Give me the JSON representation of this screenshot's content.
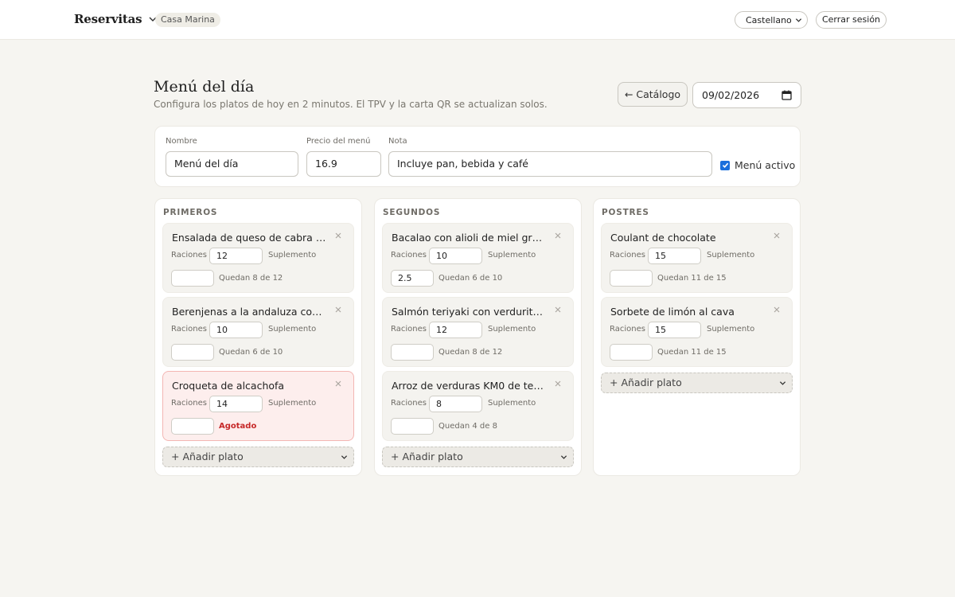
{
  "topbar": {
    "brand": "Reservitas",
    "restaurant": "Casa Marina",
    "language": "Castellano",
    "logout_label": "Cerrar sesión"
  },
  "header": {
    "title": "Menú del día",
    "subtitle": "Configura los platos de hoy en 2 minutos. El TPV y la carta QR se actualizan solos.",
    "catalog_button": "← Catálogo",
    "date": "09/02/2026"
  },
  "settings": {
    "name_label": "Nombre",
    "name_value": "Menú del día",
    "price_label": "Precio del menú",
    "price_value": "16.9",
    "note_label": "Nota",
    "note_value": "Incluye pan, bebida y café",
    "active_label": "Menú activo",
    "active": true
  },
  "labels": {
    "portions": "Raciones",
    "supplement": "Suplemento",
    "add_dish": "+ Añadir plato"
  },
  "courses": [
    {
      "title": "PRIMEROS",
      "dishes": [
        {
          "name": "Ensalada de queso de cabra y ...",
          "portions": "12",
          "supplement": "",
          "status": "Quedan 8 de 12",
          "sold_out": false
        },
        {
          "name": "Berenjenas a la andaluza con ...",
          "portions": "10",
          "supplement": "",
          "status": "Quedan 6 de 10",
          "sold_out": false
        },
        {
          "name": "Croqueta de alcachofa",
          "portions": "14",
          "supplement": "",
          "status": "Agotado",
          "sold_out": true
        }
      ]
    },
    {
      "title": "SEGUNDOS",
      "dishes": [
        {
          "name": "Bacalao con alioli de miel grati...",
          "portions": "10",
          "supplement": "2.5",
          "status": "Quedan 6 de 10",
          "sold_out": false
        },
        {
          "name": "Salmón teriyaki con verduritas ...",
          "portions": "12",
          "supplement": "",
          "status": "Quedan 8 de 12",
          "sold_out": false
        },
        {
          "name": "Arroz de verduras KM0 de tem...",
          "portions": "8",
          "supplement": "",
          "status": "Quedan 4 de 8",
          "sold_out": false
        }
      ]
    },
    {
      "title": "POSTRES",
      "dishes": [
        {
          "name": "Coulant de chocolate",
          "portions": "15",
          "supplement": "",
          "status": "Quedan 11 de 15",
          "sold_out": false
        },
        {
          "name": "Sorbete de limón al cava",
          "portions": "15",
          "supplement": "",
          "status": "Quedan 11 de 15",
          "sold_out": false
        }
      ]
    }
  ]
}
